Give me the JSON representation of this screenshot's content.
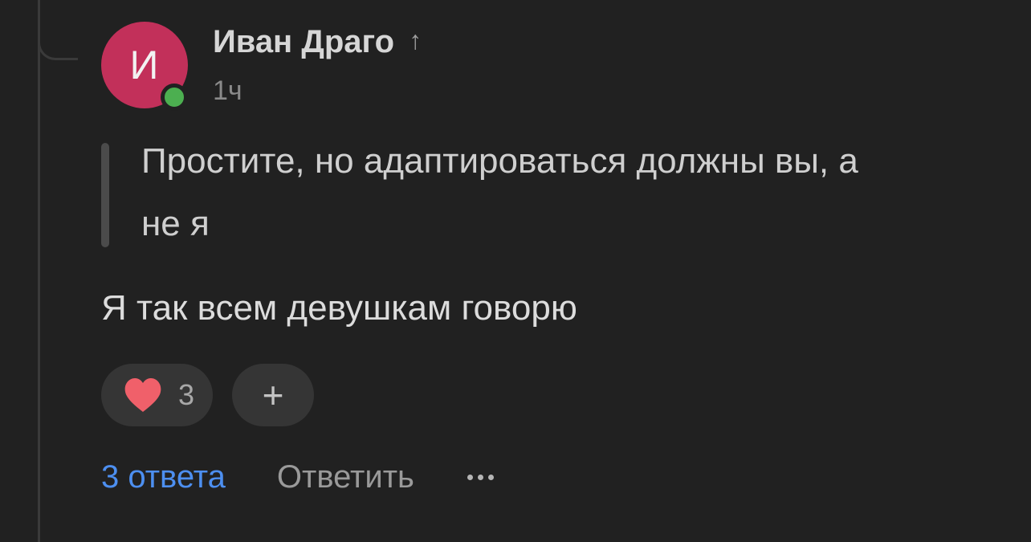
{
  "comment": {
    "avatar_letter": "И",
    "avatar_color": "#c2305a",
    "online_status_color": "#4caf50",
    "author": "Иван Драго",
    "author_badge": "↑",
    "timestamp": "1ч",
    "quote": "Простите, но адаптироваться должны вы, а не я",
    "text": "Я так всем девушкам говорю"
  },
  "reactions": {
    "like_icon": "heart-icon",
    "like_count": "3",
    "add_label": "+"
  },
  "actions": {
    "replies_label": "3 ответа",
    "reply_label": "Ответить",
    "more_icon": "ellipsis-icon"
  },
  "colors": {
    "background": "#212121",
    "link": "#4d8ff0",
    "heart": "#f0606a"
  }
}
